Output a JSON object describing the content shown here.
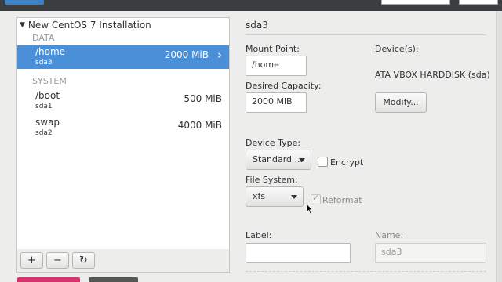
{
  "header": {
    "accent_color": "#3c82c6"
  },
  "tree": {
    "title": "New CentOS 7 Installation",
    "sections": [
      {
        "label": "DATA",
        "items": [
          {
            "mount": "/home",
            "device": "sda3",
            "size": "2000 MiB",
            "selected": true
          }
        ]
      },
      {
        "label": "SYSTEM",
        "items": [
          {
            "mount": "/boot",
            "device": "sda1",
            "size": "500 MiB",
            "selected": false
          },
          {
            "mount": "swap",
            "device": "sda2",
            "size": "4000 MiB",
            "selected": false
          }
        ]
      }
    ],
    "selected_color": "#4a90d9"
  },
  "toolbar": {
    "add": "+",
    "remove": "−",
    "refresh": "↻"
  },
  "details": {
    "title": "sda3",
    "mount_point_label": "Mount Point:",
    "mount_point_value": "/home",
    "capacity_label": "Desired Capacity:",
    "capacity_value": "2000 MiB",
    "devices_label": "Device(s):",
    "devices_value": "ATA VBOX HARDDISK (sda)",
    "modify_button": "Modify...",
    "device_type_label": "Device Type:",
    "device_type_value": "Standard ...",
    "encrypt_label": "Encrypt",
    "file_system_label": "File System:",
    "file_system_value": "xfs",
    "reformat_label": "Reformat",
    "label_label": "Label:",
    "label_value": "",
    "name_label": "Name:",
    "name_value": "sda3"
  },
  "bottom_bars": {
    "red": "#d6336c",
    "gray": "#555753"
  }
}
